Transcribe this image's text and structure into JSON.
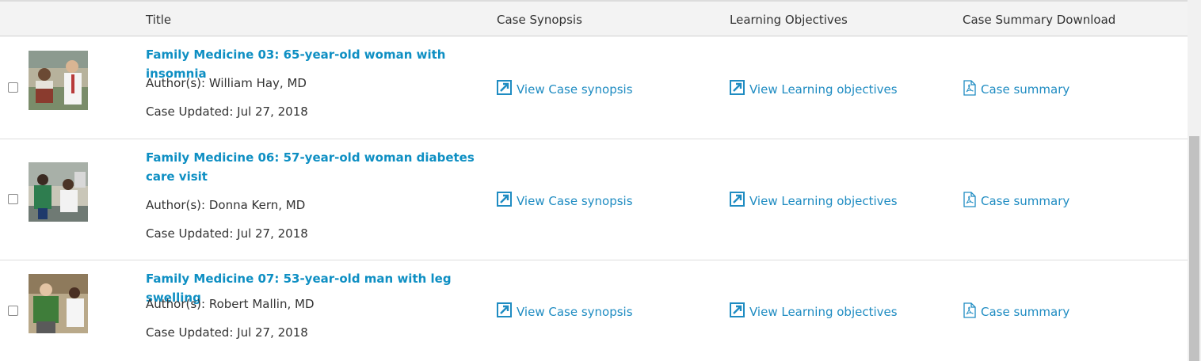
{
  "header": {
    "title": "Title",
    "synopsis": "Case Synopsis",
    "objectives": "Learning Objectives",
    "download": "Case Summary Download"
  },
  "rows": [
    {
      "title": "Family Medicine 03: 65-year-old woman with insomnia",
      "author": "Author(s): William Hay, MD",
      "updated": "Case Updated: Jul 27, 2018",
      "synopsis_link": "View Case synopsis",
      "objectives_link": "View Learning objectives",
      "summary_link": "Case summary"
    },
    {
      "title": "Family Medicine 06: 57-year-old woman diabetes care visit",
      "author": "Author(s): Donna Kern, MD",
      "updated": "Case Updated: Jul 27, 2018",
      "synopsis_link": "View Case synopsis",
      "objectives_link": "View Learning objectives",
      "summary_link": "Case summary"
    },
    {
      "title": "Family Medicine 07: 53-year-old man with leg swelling",
      "author": "Author(s): Robert Mallin, MD",
      "updated": "Case Updated: Jul 27, 2018",
      "synopsis_link": "View Case synopsis",
      "objectives_link": "View Learning objectives",
      "summary_link": "Case summary"
    }
  ],
  "icons": {
    "external_link": "external-link-arrow-icon",
    "pdf": "pdf-file-icon"
  },
  "colors": {
    "link": "#1f8cc2",
    "title_link": "#0e8fc3",
    "header_bg": "#f3f3f3"
  }
}
